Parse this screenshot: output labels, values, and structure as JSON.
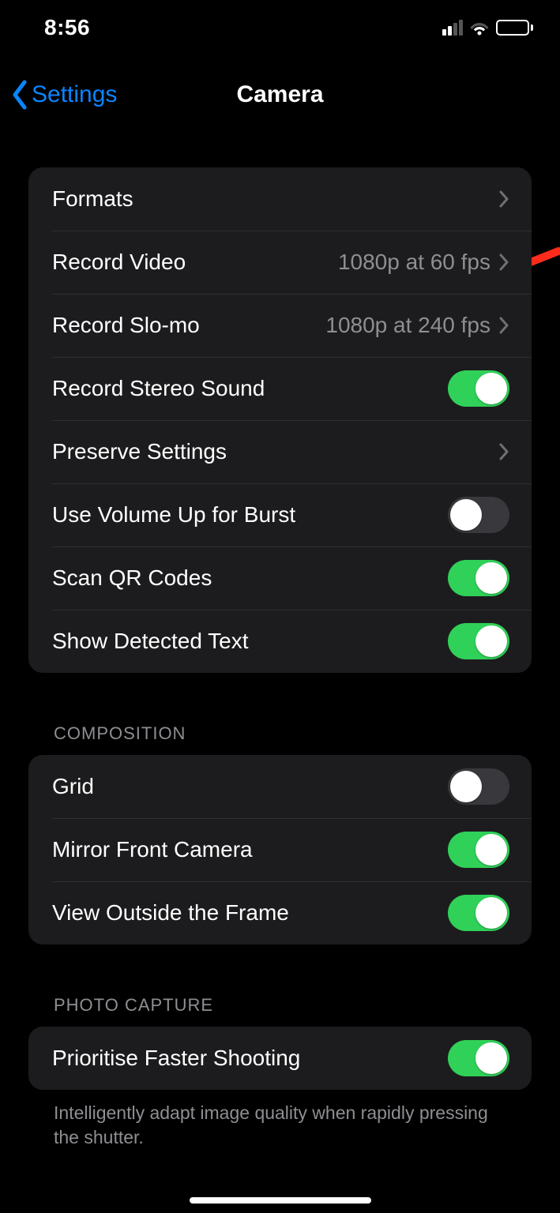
{
  "status": {
    "time": "8:56"
  },
  "nav": {
    "back_label": "Settings",
    "title": "Camera"
  },
  "group1": {
    "rows": [
      {
        "label": "Formats",
        "type": "link"
      },
      {
        "label": "Record Video",
        "value": "1080p at 60 fps",
        "type": "link"
      },
      {
        "label": "Record Slo-mo",
        "value": "1080p at 240 fps",
        "type": "link"
      },
      {
        "label": "Record Stereo Sound",
        "type": "toggle",
        "on": true
      },
      {
        "label": "Preserve Settings",
        "type": "link"
      },
      {
        "label": "Use Volume Up for Burst",
        "type": "toggle",
        "on": false
      },
      {
        "label": "Scan QR Codes",
        "type": "toggle",
        "on": true
      },
      {
        "label": "Show Detected Text",
        "type": "toggle",
        "on": true
      }
    ]
  },
  "group2": {
    "header": "COMPOSITION",
    "rows": [
      {
        "label": "Grid",
        "type": "toggle",
        "on": false
      },
      {
        "label": "Mirror Front Camera",
        "type": "toggle",
        "on": true
      },
      {
        "label": "View Outside the Frame",
        "type": "toggle",
        "on": true
      }
    ]
  },
  "group3": {
    "header": "PHOTO CAPTURE",
    "rows": [
      {
        "label": "Prioritise Faster Shooting",
        "type": "toggle",
        "on": true
      }
    ],
    "footer": "Intelligently adapt image quality when rapidly pressing the shutter."
  }
}
